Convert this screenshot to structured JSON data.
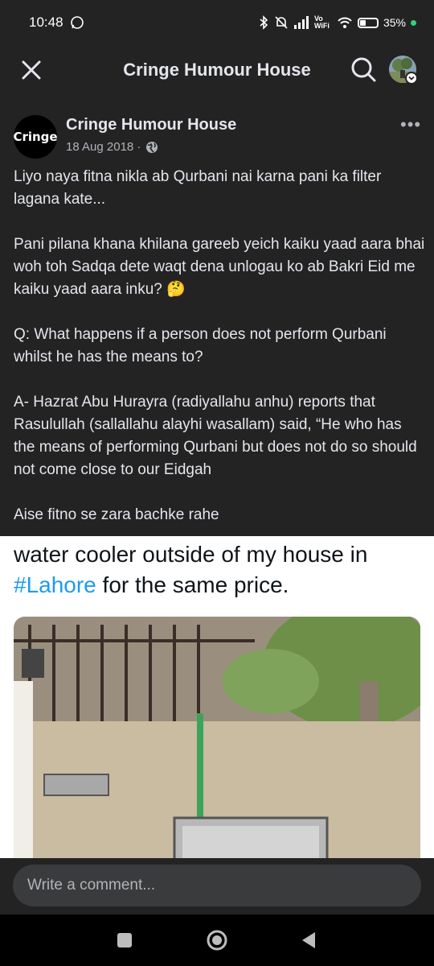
{
  "status_bar": {
    "time": "10:48",
    "network_label": "Vo WiFi",
    "battery": "35%"
  },
  "top_nav": {
    "title": "Cringe Humour House"
  },
  "post": {
    "page_name": "Cringe Humour House",
    "avatar_text": "Cringe",
    "date": "18 Aug 2018 ·",
    "more": "•••",
    "paragraphs": [
      "Liyo naya fitna nikla ab Qurbani nai karna pani ka filter lagana kate...",
      "Pani pilana khana khilana gareeb yeich kaiku yaad aara bhai woh toh Sadqa dete waqt dena unlogau ko ab Bakri Eid me kaiku yaad aara inku? 🤔",
      "Q: What happens if a person does not perform Qurbani whilst he has the means to?",
      "A- Hazrat Abu Hurayra (radiyallahu anhu) reports that Rasulullah (sallallahu alayhi wasallam) said, “He who has the means of performing Qurbani but does not do so should not come close to our Eidgah",
      "Aise fitno se zara bachke rahe"
    ]
  },
  "shared_image": {
    "text_before": "water cooler outside of my house in",
    "hashtag": "#Lahore",
    "text_after": " for the same price."
  },
  "comment": {
    "placeholder": "Write a comment..."
  },
  "icons": {
    "close": "close-icon",
    "search": "search-icon",
    "globe": "globe-icon",
    "recents": "recents-icon",
    "home": "home-icon",
    "back": "back-icon"
  }
}
